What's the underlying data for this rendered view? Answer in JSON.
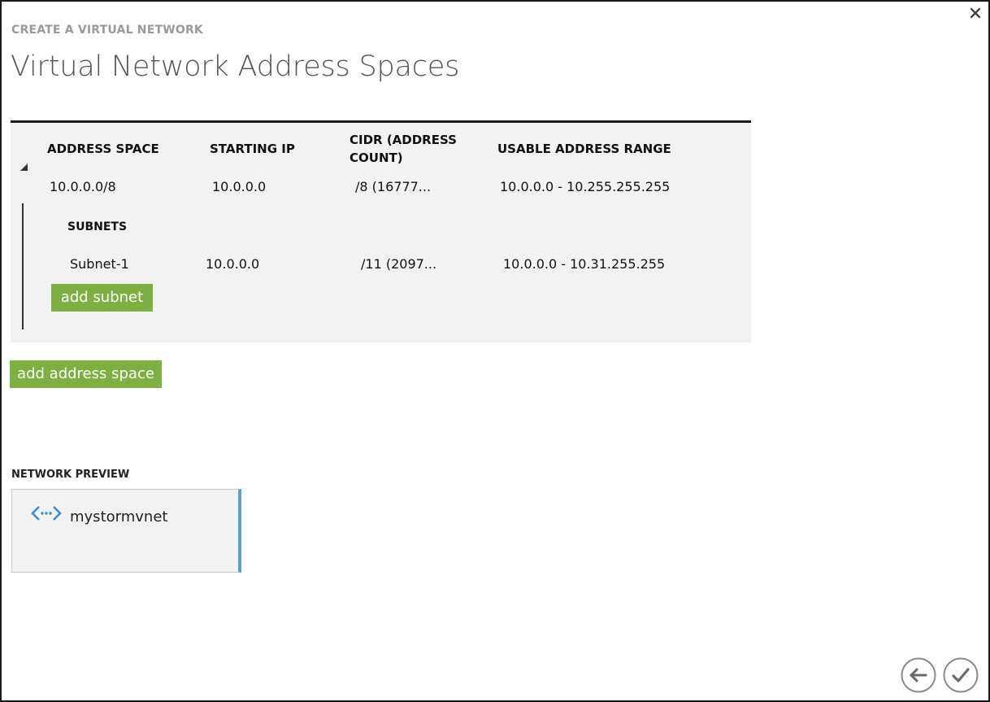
{
  "wizard": {
    "step_label": "CREATE A VIRTUAL NETWORK",
    "title": "Virtual Network Address Spaces"
  },
  "address_table": {
    "columns": [
      "ADDRESS SPACE",
      "STARTING IP",
      "CIDR (ADDRESS COUNT)",
      "USABLE ADDRESS RANGE"
    ],
    "address_space": {
      "address_space": "10.0.0.0/8",
      "starting_ip": "10.0.0.0",
      "cidr": "/8 (16777...",
      "usable_range": "10.0.0.0 - 10.255.255.255"
    },
    "subnets_heading": "SUBNETS",
    "subnets": [
      {
        "name": "Subnet-1",
        "starting_ip": "10.0.0.0",
        "cidr": "/11 (2097...",
        "usable_range": "10.0.0.0 - 10.31.255.255"
      }
    ],
    "add_subnet_label": "add subnet"
  },
  "add_address_space_label": "add address space",
  "preview": {
    "label": "NETWORK PREVIEW",
    "network_name": "mystormvnet",
    "icon": "virtual-network-icon"
  },
  "navigation": {
    "back_icon": "back-arrow-icon",
    "finish_icon": "checkmark-icon"
  },
  "colors": {
    "button_green": "#7cb042",
    "panel_gray": "#f2f2f2",
    "accent_blue": "#5a9fd0"
  }
}
